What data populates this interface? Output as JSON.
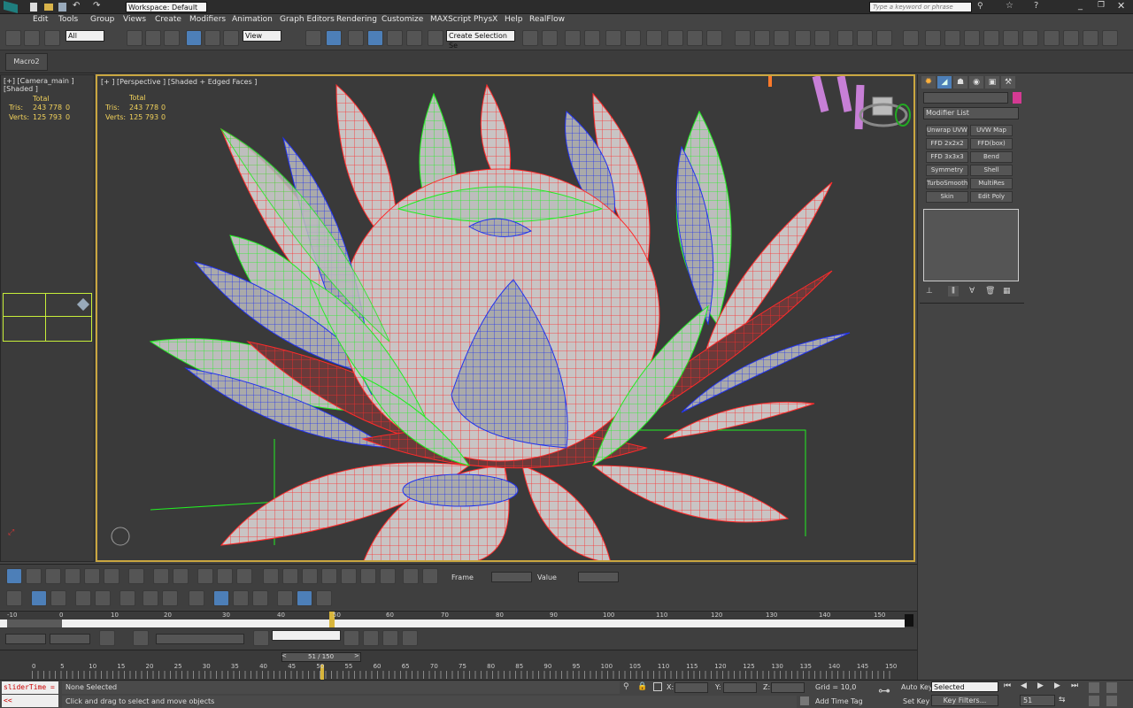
{
  "titlebar": {
    "workspace": "Workspace: Default",
    "search_placeholder": "Type a keyword or phrase"
  },
  "menu": [
    "Edit",
    "Tools",
    "Group",
    "Views",
    "Create",
    "Modifiers",
    "Animation",
    "Graph Editors",
    "Rendering",
    "Customize",
    "MAXScript",
    "PhysX",
    "Help",
    "RealFlow"
  ],
  "toolbar": {
    "filter_value": "All",
    "ref_coord": "View",
    "selection_set": "Create Selection Se",
    "count_snap": "3",
    "snap_angle": "%"
  },
  "tabs": {
    "macro": "Macro2"
  },
  "left_viewport": {
    "label": "[+] [Camera_main ] [Shaded ]",
    "stats": {
      "header": "Total",
      "tris_label": "Tris:",
      "tris_value": "243 778",
      "tris_sel": "0",
      "verts_label": "Verts:",
      "verts_value": "125 793",
      "verts_sel": "0"
    }
  },
  "main_viewport": {
    "label": "[+ ] [Perspective ] [Shaded + Edged Faces ]",
    "stats": {
      "header": "Total",
      "tris_label": "Tris:",
      "tris_value": "243 778",
      "tris_sel": "0",
      "verts_label": "Verts:",
      "verts_value": "125 793",
      "verts_sel": "0"
    }
  },
  "command_panel": {
    "modifier_list": "Modifier List",
    "buttons": [
      "Unwrap UVW",
      "UVW Map",
      "FFD 2x2x2",
      "FFD(box)",
      "FFD 3x3x3",
      "Bend",
      "Symmetry",
      "Shell",
      "TurboSmooth",
      "MultiRes",
      "Skin",
      "Edit Poly"
    ]
  },
  "bottom": {
    "frame_label": "Frame",
    "value_label": "Value"
  },
  "time_ruler": {
    "ticks": [
      "-10",
      "0",
      "10",
      "20",
      "30",
      "40",
      "50",
      "60",
      "70",
      "80",
      "90",
      "100",
      "110",
      "120",
      "130",
      "140",
      "150"
    ],
    "current_frame_marker": "50"
  },
  "trackbar": {
    "position": "51 / 150",
    "ticks": [
      "0",
      "5",
      "10",
      "15",
      "20",
      "25",
      "30",
      "35",
      "40",
      "45",
      "50",
      "55",
      "60",
      "65",
      "70",
      "75",
      "80",
      "85",
      "90",
      "95",
      "100",
      "105",
      "110",
      "115",
      "120",
      "125",
      "130",
      "135",
      "140",
      "145",
      "150"
    ]
  },
  "status": {
    "maxscript": "sliderTime =",
    "maxscript2": "<<",
    "selection": "None Selected",
    "prompt": "Click and drag to select and move objects",
    "x_label": "X:",
    "y_label": "Y:",
    "z_label": "Z:",
    "grid": "Grid = 10,0",
    "add_time_tag": "Add Time Tag",
    "auto_key": "Auto Key",
    "set_key": "Set Key",
    "key_mode": "Selected",
    "key_filters": "Key Filters...",
    "frame": "51"
  },
  "colors": {
    "accent": "#c9a640",
    "wire_red": "#ff2a2a",
    "wire_green": "#22ee22",
    "wire_blue": "#2233ee",
    "stat_yellow": "#f2d25b"
  }
}
